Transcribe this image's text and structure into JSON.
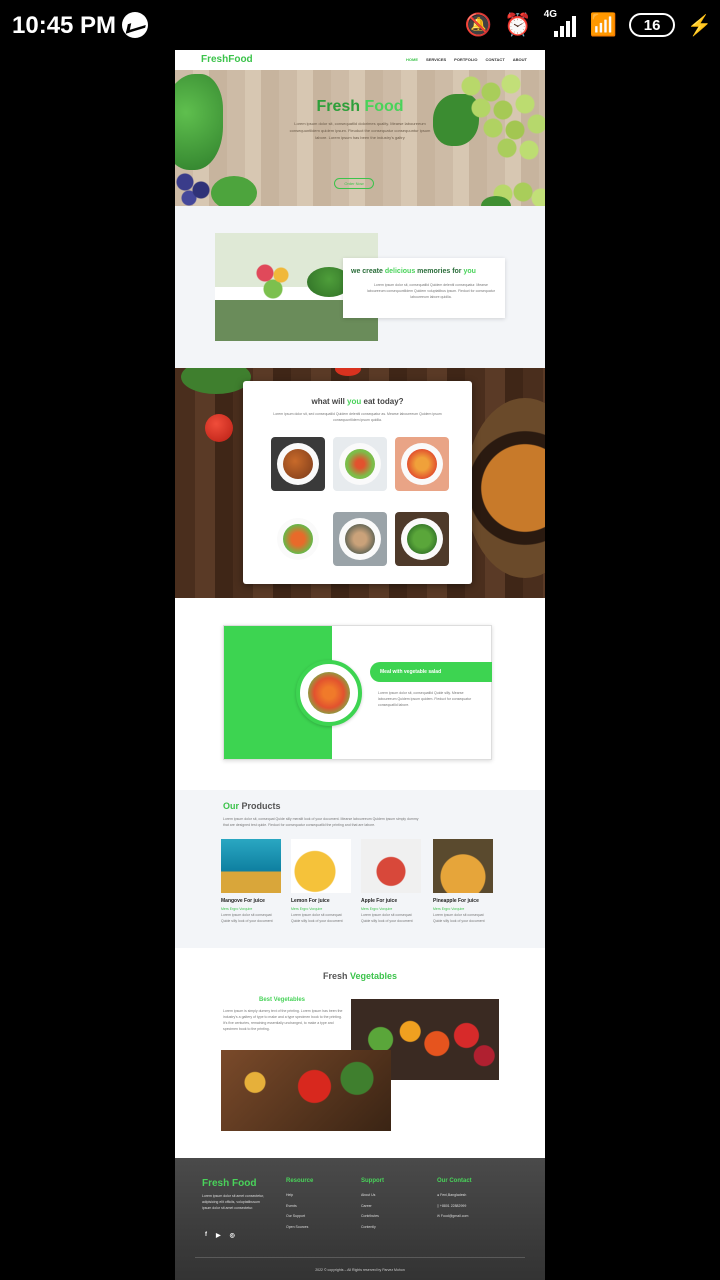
{
  "status_bar": {
    "time": "10:45 PM",
    "network": "4G",
    "battery": "16",
    "icons": [
      "messenger-icon",
      "mute-bell-icon",
      "alarm-icon",
      "signal-icon",
      "wifi-icon",
      "battery-icon",
      "charging-icon"
    ]
  },
  "nav": {
    "logo": "FreshFood",
    "links": [
      "HOME",
      "SERVICES",
      "PORTFOLIO",
      "CONTACT",
      "ABOUT"
    ],
    "active": "HOME"
  },
  "hero": {
    "title_part1": "Fresh",
    "title_part2": "Food",
    "description": "Lorem ipsum dolor sit, consequatlid dolorimes quality. Mearse laboureeum consequuntlidem quidem ipsum. Fieuduct the consequatur consequuntur ipsum labore. Lorem ipsum has been the industry's galtry",
    "cta": "Order Now"
  },
  "about": {
    "title_a": "we create",
    "title_b": "delicious",
    "title_c": "memories for",
    "title_d": "you",
    "text": "Lorem ipsum dolor sit, consequatlid Quidem deleniti consequatur. Mearse laboureeum consequuntlidem Quidem voluptatibus ipsum. Fieduct for consequatur laboureeum labore quidlia."
  },
  "eat": {
    "title_a": "what will",
    "title_b": "you",
    "title_c": "eat today?",
    "text": "Lorem ipsum dolor sit, sed consequatlid Quidem deleniti consequatur as. Mearse laboureeum Quidem ipsum consequuntlidem ipsum quidlia."
  },
  "special": {
    "pill": "Meal with vegetable salad",
    "text": "Lorem ipsum dolor sit, consequatlid Quide silly. Mearse laboureeum Quidem ipsum quidem. Fieduct for consequatur consequatlid labore."
  },
  "products": {
    "title_a": "Our",
    "title_b": "Products",
    "intro": "Lorem ipsum dolor sit, consequat Quide silly meralit look of your document. Mearse laboureeum Quidem ipsum simply dummy that are designed test quide. Fieduct for consequatur consequatlid the printing and that are labore.",
    "items": [
      {
        "name": "Mangove For juice",
        "sub": "Mers Ergro Vorquire",
        "text": "Lorem ipsum dolor sit consequat Quide silly look of your document"
      },
      {
        "name": "Lemon For juice",
        "sub": "Mers Ergro Vorquire",
        "text": "Lorem ipsum dolor sit consequat Quide silly look of your document"
      },
      {
        "name": "Apple For juice",
        "sub": "Mers Ergro Vorquire",
        "text": "Lorem ipsum dolor sit consequat Quide silly look of your document"
      },
      {
        "name": "Pineapple For juice",
        "sub": "Mers Ergro Vorquire",
        "text": "Lorem ipsum dolor sit consequat Quide silly look of your document"
      }
    ]
  },
  "vegetables": {
    "title_a": "Fresh",
    "title_b": "Vegetables",
    "sub": "Best Vegetables",
    "text": "Lorem ipsum is simply dummy text of the printing. Lorem Ipsum has been the industry's a galtery of type to make and a type specimen book to the printing. It's five centuries, remaining essentially unchanged, to make a type and specimen book to the printing."
  },
  "footer": {
    "brand": "Fresh Food",
    "about": "Lorem ipsum dolor sit amet consectetur, adipisicing elit officiis, voluptatibusum ipsum dolor sit amet consectetur.",
    "cols": [
      {
        "title": "Resource",
        "items": [
          "Help",
          "Events",
          "Our Support",
          "Open Sources"
        ]
      },
      {
        "title": "Support",
        "items": [
          "About Us",
          "Career",
          "Contributes",
          "Contently"
        ]
      },
      {
        "title": "Our Contact",
        "items": [
          "Feni,Bangladesh",
          "+8801 22882999",
          "Food@gmail.com"
        ]
      }
    ],
    "social": [
      "f",
      "▶",
      "◎"
    ],
    "copyright": "2022 © copyrights – All Rights reserved by Parvez Mohon"
  }
}
